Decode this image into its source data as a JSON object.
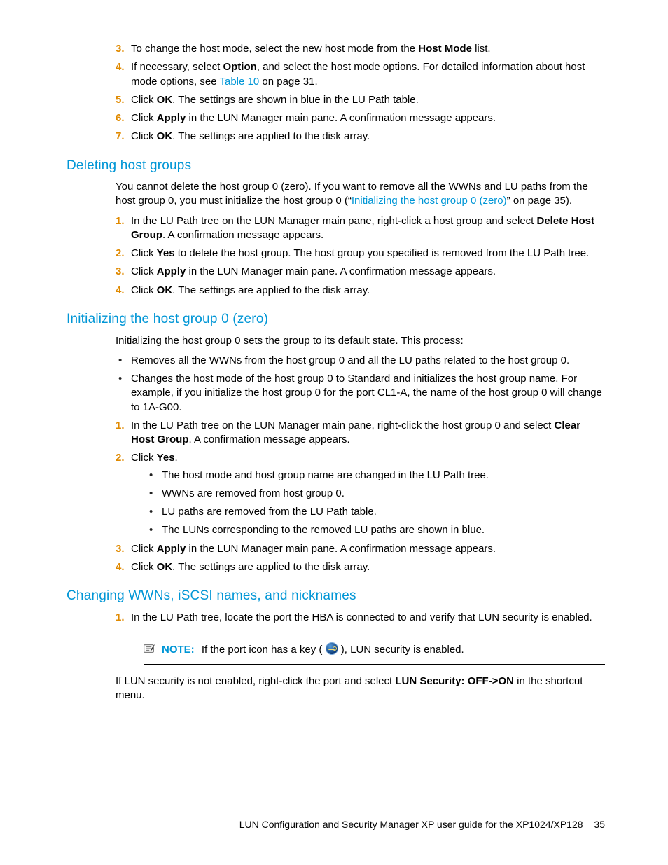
{
  "top_steps": [
    {
      "n": "3.",
      "pre": "To change the host mode, select the new host mode from the ",
      "b1": "Host Mode",
      "post": " list."
    },
    {
      "n": "4.",
      "pre": "If necessary, select ",
      "b1": "Option",
      "mid": ", and select the host mode options. For detailed information about host mode options, see ",
      "link": "Table 10",
      "post": " on page 31."
    },
    {
      "n": "5.",
      "pre": "Click ",
      "b1": "OK",
      "post": ". The settings are shown in blue in the LU Path table."
    },
    {
      "n": "6.",
      "pre": "Click ",
      "b1": "Apply",
      "post": " in the LUN Manager main pane. A confirmation message appears."
    },
    {
      "n": "7.",
      "pre": "Click ",
      "b1": "OK",
      "post": ". The settings are applied to the disk array."
    }
  ],
  "sec1": {
    "title": "Deleting host groups",
    "intro_pre": "You cannot delete the host group 0 (zero). If you want to remove all the WWNs and LU paths from the host group 0, you must initialize the host group 0 (“",
    "intro_link": "Initializing the host group 0 (zero)",
    "intro_post": "” on page 35).",
    "steps": [
      {
        "n": "1.",
        "pre": "In the LU Path tree on the LUN Manager main pane, right-click a host group and select ",
        "b1": "Delete Host Group",
        "post": ". A confirmation message appears."
      },
      {
        "n": "2.",
        "pre": "Click ",
        "b1": "Yes",
        "post": " to delete the host group. The host group you specified is removed from the LU Path tree."
      },
      {
        "n": "3.",
        "pre": "Click ",
        "b1": "Apply",
        "post": " in the LUN Manager main pane. A confirmation message appears."
      },
      {
        "n": "4.",
        "pre": "Click ",
        "b1": "OK",
        "post": ". The settings are applied to the disk array."
      }
    ]
  },
  "sec2": {
    "title": "Initializing the host group 0 (zero)",
    "intro": "Initializing the host group 0 sets the group to its default state. This process:",
    "bullets": [
      "Removes all the WWNs from the host group 0 and all the LU paths related to the host group 0.",
      "Changes the host mode of the host group 0 to Standard and initializes the host group name. For example, if you initialize the host group 0 for the port CL1-A, the name of the host group 0 will change to 1A-G00."
    ],
    "steps": [
      {
        "n": "1.",
        "pre": "In the LU Path tree on the LUN Manager main pane, right-click the host group 0 and select ",
        "b1": "Clear Host Group",
        "post": ". A confirmation message appears."
      },
      {
        "n": "2.",
        "pre": "Click ",
        "b1": "Yes",
        "post": ".",
        "sub": [
          "The host mode and host group name are changed in the LU Path tree.",
          "WWNs are removed from host group 0.",
          "LU paths are removed from the LU Path table.",
          "The LUNs corresponding to the removed LU paths are shown in blue."
        ]
      },
      {
        "n": "3.",
        "pre": "Click ",
        "b1": "Apply",
        "post": " in the LUN Manager main pane. A confirmation message appears."
      },
      {
        "n": "4.",
        "pre": "Click ",
        "b1": "OK",
        "post": ". The settings are applied to the disk array."
      }
    ]
  },
  "sec3": {
    "title": "Changing WWNs, iSCSI names, and nicknames",
    "step1": {
      "n": "1.",
      "text": "In the LU Path tree, locate the port the HBA is connected to and verify that LUN security is enabled."
    },
    "note_label": "NOTE:",
    "note_pre": "If the port icon has a key (",
    "note_post": "), LUN security is enabled.",
    "after_pre": "If LUN security is not enabled, right-click the port and select ",
    "after_bold": "LUN Security: OFF->ON",
    "after_post": " in the shortcut menu."
  },
  "footer": {
    "text": "LUN Configuration and Security Manager XP user guide for the XP1024/XP128",
    "page": "35"
  }
}
